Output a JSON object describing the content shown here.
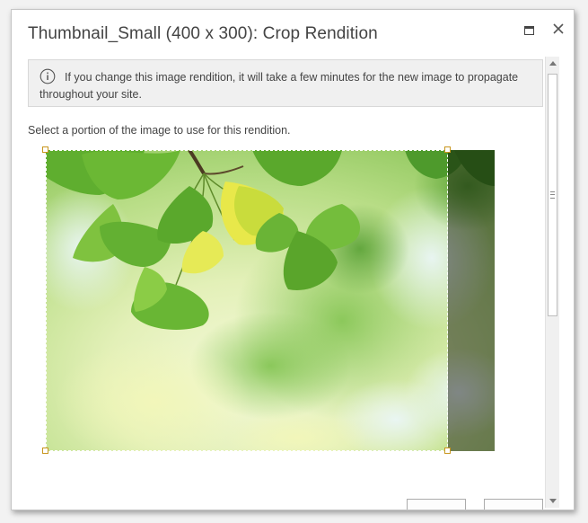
{
  "dialog": {
    "title": "Thumbnail_Small (400 x 300): Crop Rendition",
    "maximize_icon": "maximize-icon",
    "close_icon": "close-icon"
  },
  "notice": {
    "icon": "info-icon",
    "text": "If you change this image rendition, it will take a few minutes for the new image to propagate throughout your site."
  },
  "instruction": "Select a portion of the image to use for this rendition.",
  "image": {
    "subject": "ginkgo leaves",
    "accent_color": "#6fb83a",
    "handle_color": "#c8961e"
  },
  "footer": {
    "buttons": [
      "",
      ""
    ]
  }
}
